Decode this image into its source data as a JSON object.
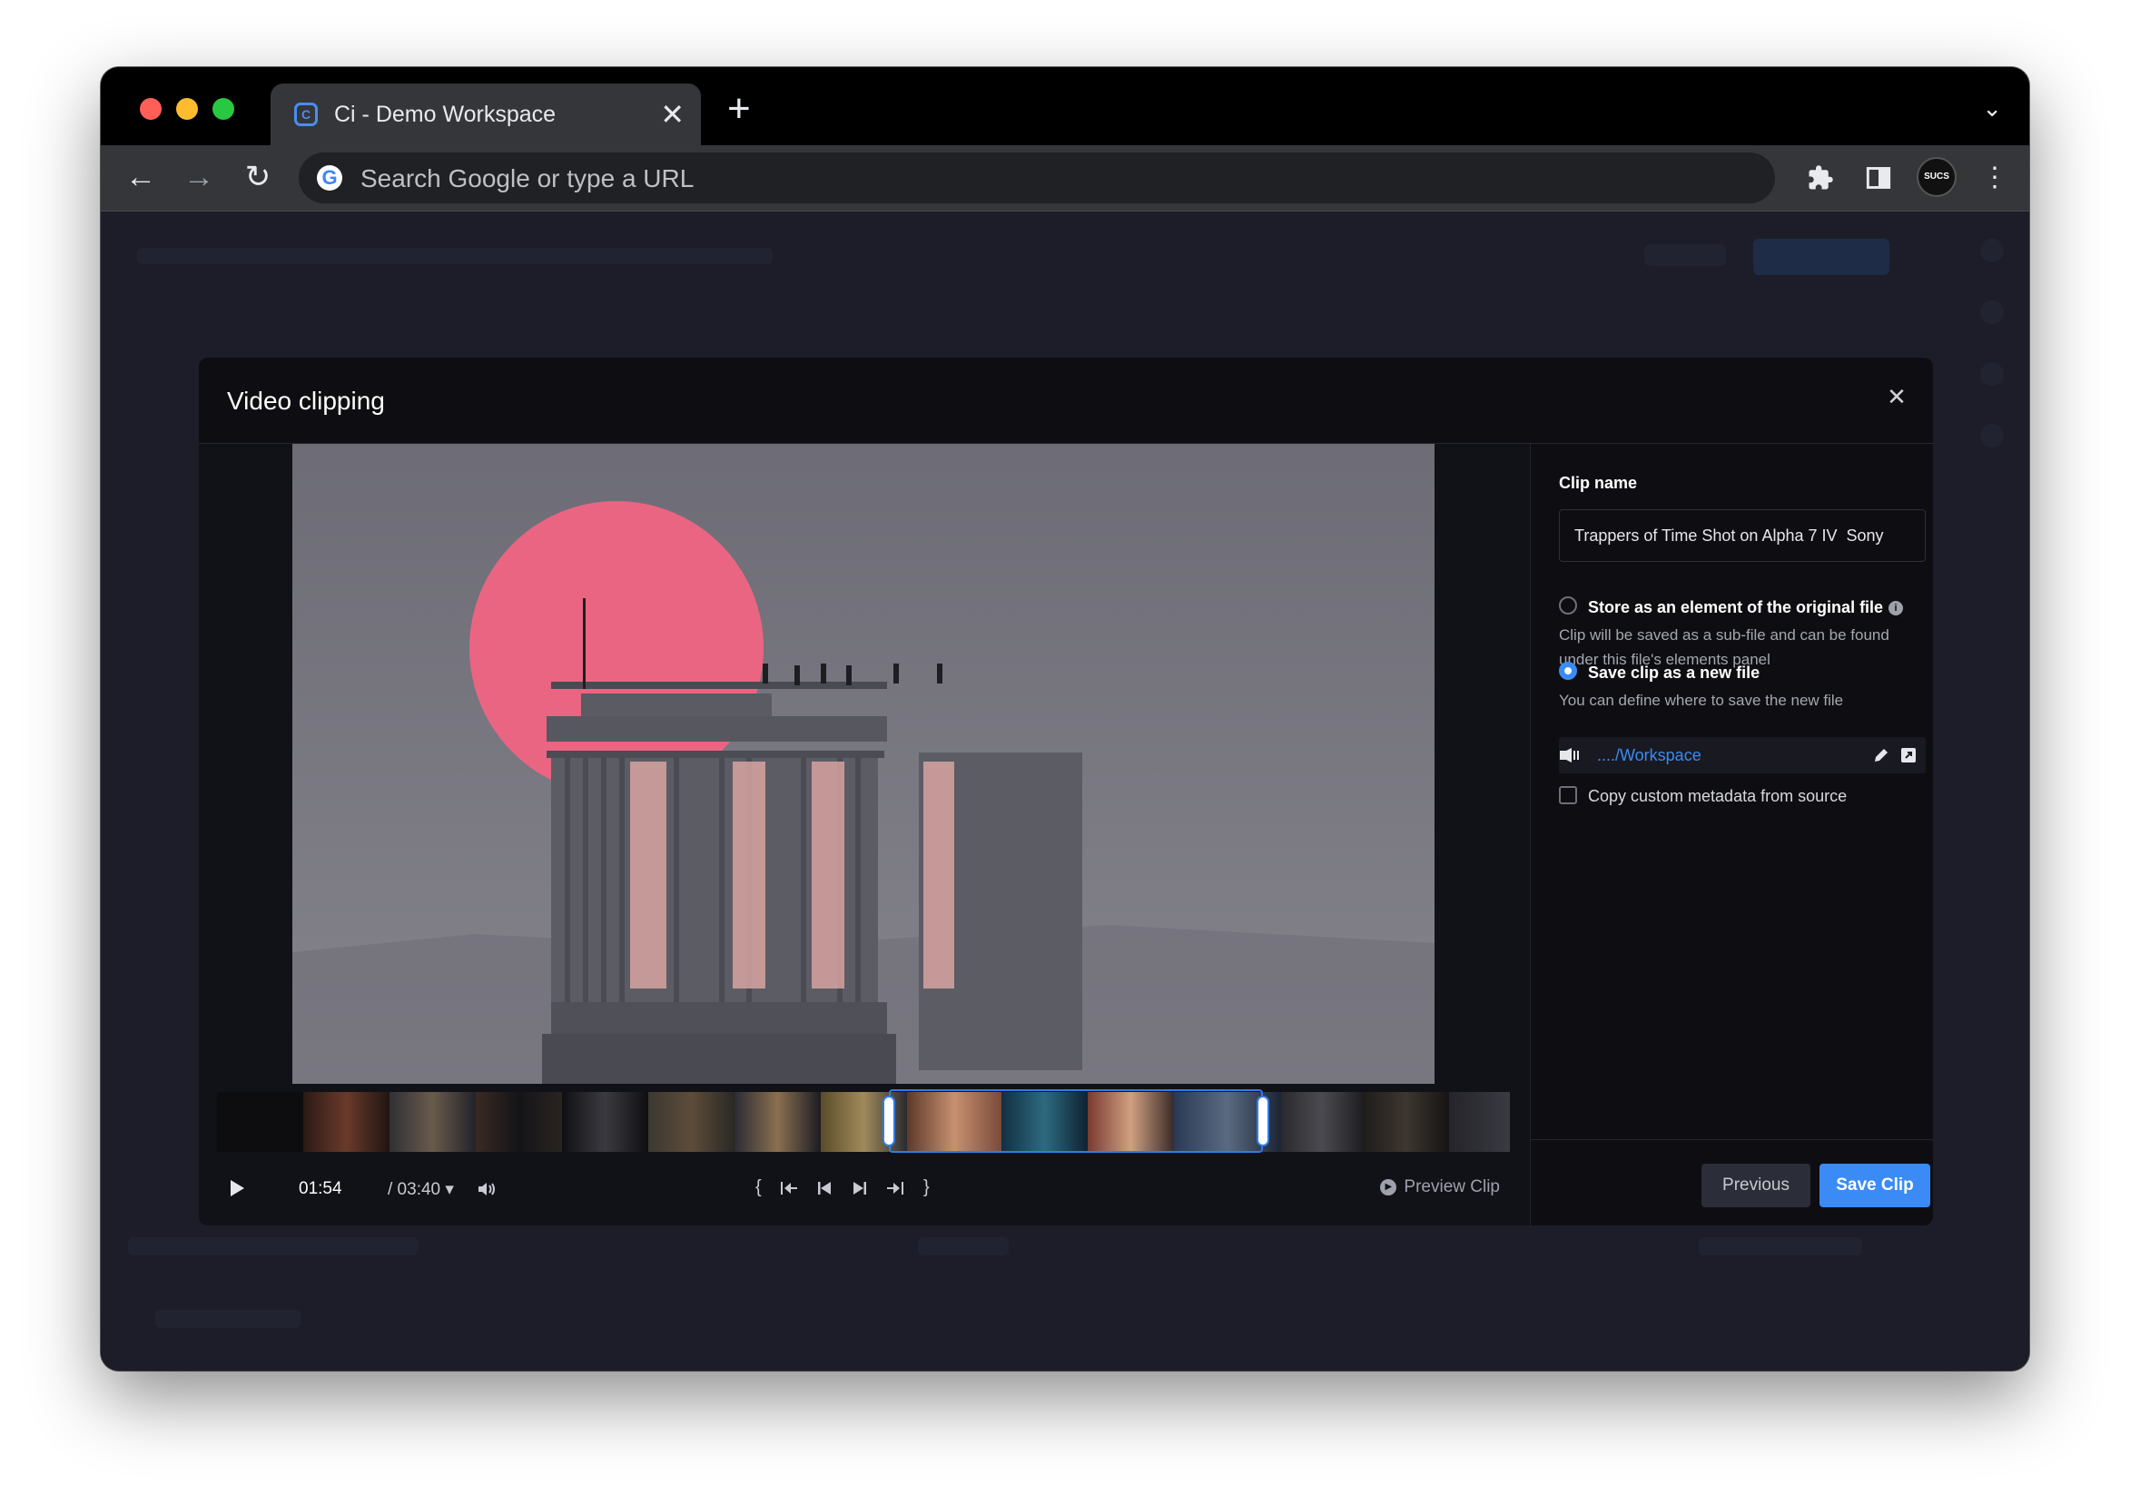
{
  "browser": {
    "tab_title": "Ci - Demo Workspace",
    "tab_favicon": "ci-logo-icon",
    "omnibox_placeholder": "Search Google or type a URL",
    "profile_label": "SUCS"
  },
  "modal": {
    "title": "Video clipping",
    "close_icon": "close-icon"
  },
  "player": {
    "current_time": "01:54",
    "total_time": "/ 03:40",
    "preview_label": "Preview Clip",
    "selection_start_fraction": 0.52,
    "selection_end_fraction": 0.81
  },
  "panel": {
    "clip_name_label": "Clip name",
    "clip_name_value": "Trappers of Time Shot on Alpha 7 IV  Sony",
    "option1_title": "Store as an element of the original file",
    "option1_desc": "Clip will be saved as a sub-file and can be found under this file's elements panel",
    "option2_title": "Save clip as a new file",
    "option2_desc": "You can define where to save the new file",
    "selected_option": 2,
    "path": "..../Workspace",
    "copy_metadata_label": "Copy custom metadata from source",
    "copy_metadata_checked": false,
    "previous_label": "Previous",
    "save_label": "Save Clip"
  },
  "colors": {
    "accent": "#3a8bf5",
    "modal_bg": "#0e0e12",
    "page_bg": "#1e1f2a"
  }
}
